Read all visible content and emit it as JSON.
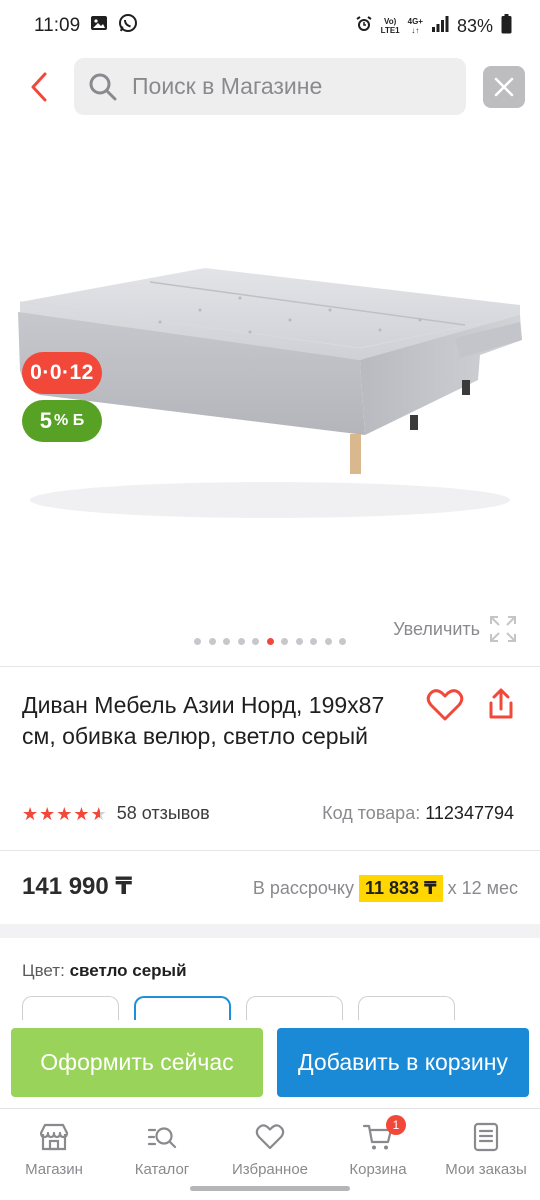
{
  "status_bar": {
    "time": "11:09",
    "network_top": "Vo)",
    "network_bottom": "LTE1",
    "signal_top": "4G+",
    "battery": "83%"
  },
  "search": {
    "placeholder": "Поиск в Магазине"
  },
  "gallery": {
    "installment_badge": "0·0·12",
    "bonus_badge_value": "5",
    "bonus_badge_suffix": "% Б",
    "zoom_label": "Увеличить",
    "dots_total": 11,
    "dots_active": 5
  },
  "product": {
    "title": "Диван Мебель Азии Норд, 199x87 см, обивка велюр, светло серый",
    "rating": 4.5,
    "reviews": "58 отзывов",
    "sku_label": "Код товара:",
    "sku_value": "112347794",
    "price": "141 990 ₸",
    "credit_label": "В рассрочку",
    "credit_monthly": "11 833 ₸",
    "credit_term": "х 12 мес",
    "color_label": "Цвет:",
    "color_value": "светло серый"
  },
  "actions": {
    "buy_now": "Оформить сейчас",
    "add_to_cart": "Добавить в корзину"
  },
  "nav": {
    "items": [
      {
        "label": "Магазин",
        "icon": "shop-icon"
      },
      {
        "label": "Каталог",
        "icon": "catalog-search-icon"
      },
      {
        "label": "Избранное",
        "icon": "heart-icon"
      },
      {
        "label": "Корзина",
        "icon": "cart-icon"
      },
      {
        "label": "Мои заказы",
        "icon": "orders-icon"
      }
    ],
    "cart_count": "1"
  },
  "colors": {
    "accent_red": "#f2483a",
    "bonus_green": "#57a225",
    "buy_green": "#9ad35a",
    "cart_blue": "#1a8ad6",
    "credit_yellow": "#ffd600"
  }
}
